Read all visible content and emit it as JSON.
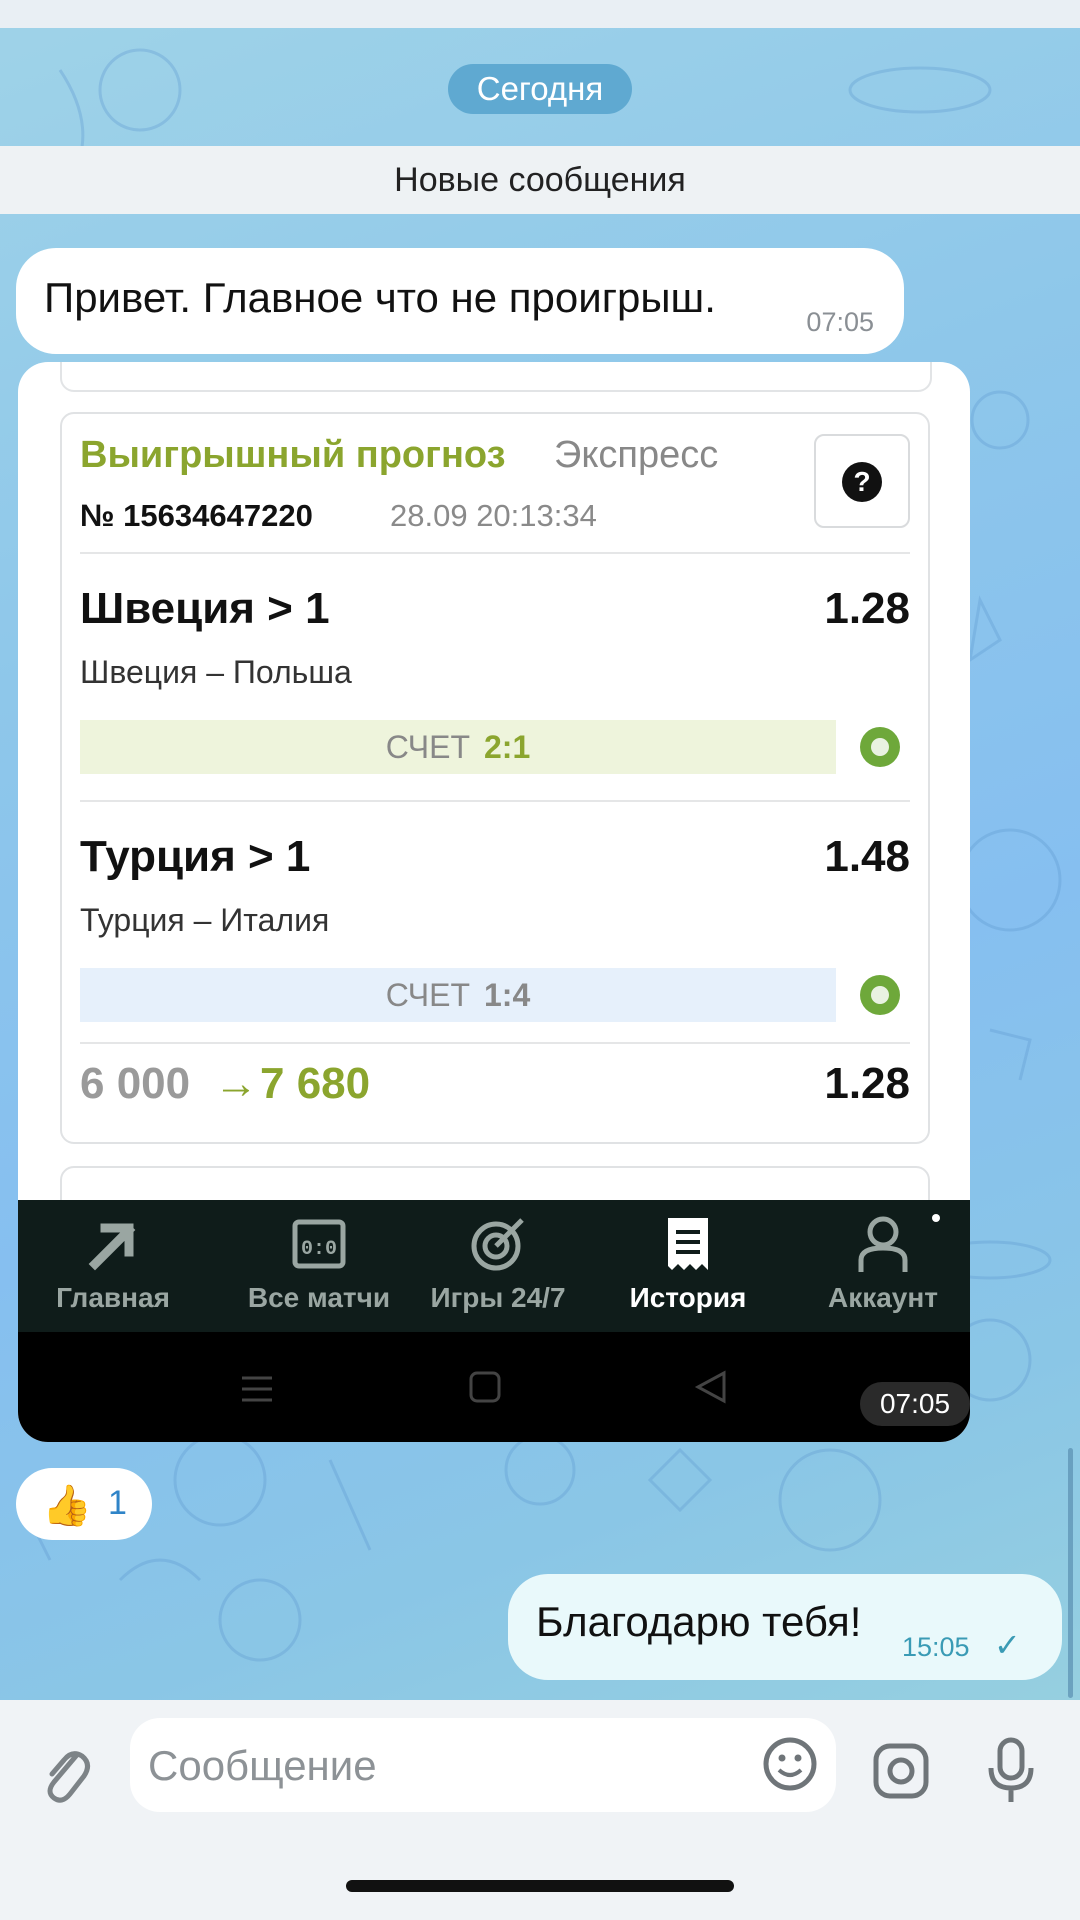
{
  "chat": {
    "date_label": "Сегодня",
    "new_messages_label": "Новые сообщения",
    "incoming_message": {
      "text": "Привет. Главное что не проигрыш.",
      "time": "07:05"
    },
    "media_time": "07:05",
    "reaction": {
      "emoji": "👍",
      "count": "1"
    },
    "outgoing_message": {
      "text": "Благодарю тебя!",
      "time": "15:05",
      "status_icon": "check-icon"
    }
  },
  "bet_card": {
    "title_highlight": "Выигрышный прогноз",
    "title_type": "Экспресс",
    "number": "№ 15634647220",
    "datetime": "28.09 20:13:34",
    "help_icon": "question-icon",
    "events": [
      {
        "pick": "Швеция > 1",
        "odds": "1.28",
        "match": "Швеция – Польша",
        "score_label": "СЧЕТ",
        "score": "2:1",
        "status": "won"
      },
      {
        "pick": "Турция > 1",
        "odds": "1.48",
        "match": "Турция – Италия",
        "score_label": "СЧЕТ",
        "score": "1:4",
        "status": "lost"
      }
    ],
    "stake": "6 000",
    "arrow": "→",
    "payout": "7 680",
    "total_odds": "1.28"
  },
  "app_nav": {
    "items": [
      {
        "label": "Главная",
        "icon": "arrow-icon"
      },
      {
        "label": "Все матчи",
        "icon": "scoreboard-icon"
      },
      {
        "label": "Игры 24/7",
        "icon": "target-icon"
      },
      {
        "label": "История",
        "icon": "receipt-icon",
        "active": true
      },
      {
        "label": "Аккаунт",
        "icon": "user-icon"
      }
    ]
  },
  "composer": {
    "placeholder": "Сообщение"
  },
  "colors": {
    "accent_green": "#8ba52e",
    "bubble_out": "#e9f9fb",
    "date_pill": "#5fa9d1"
  }
}
